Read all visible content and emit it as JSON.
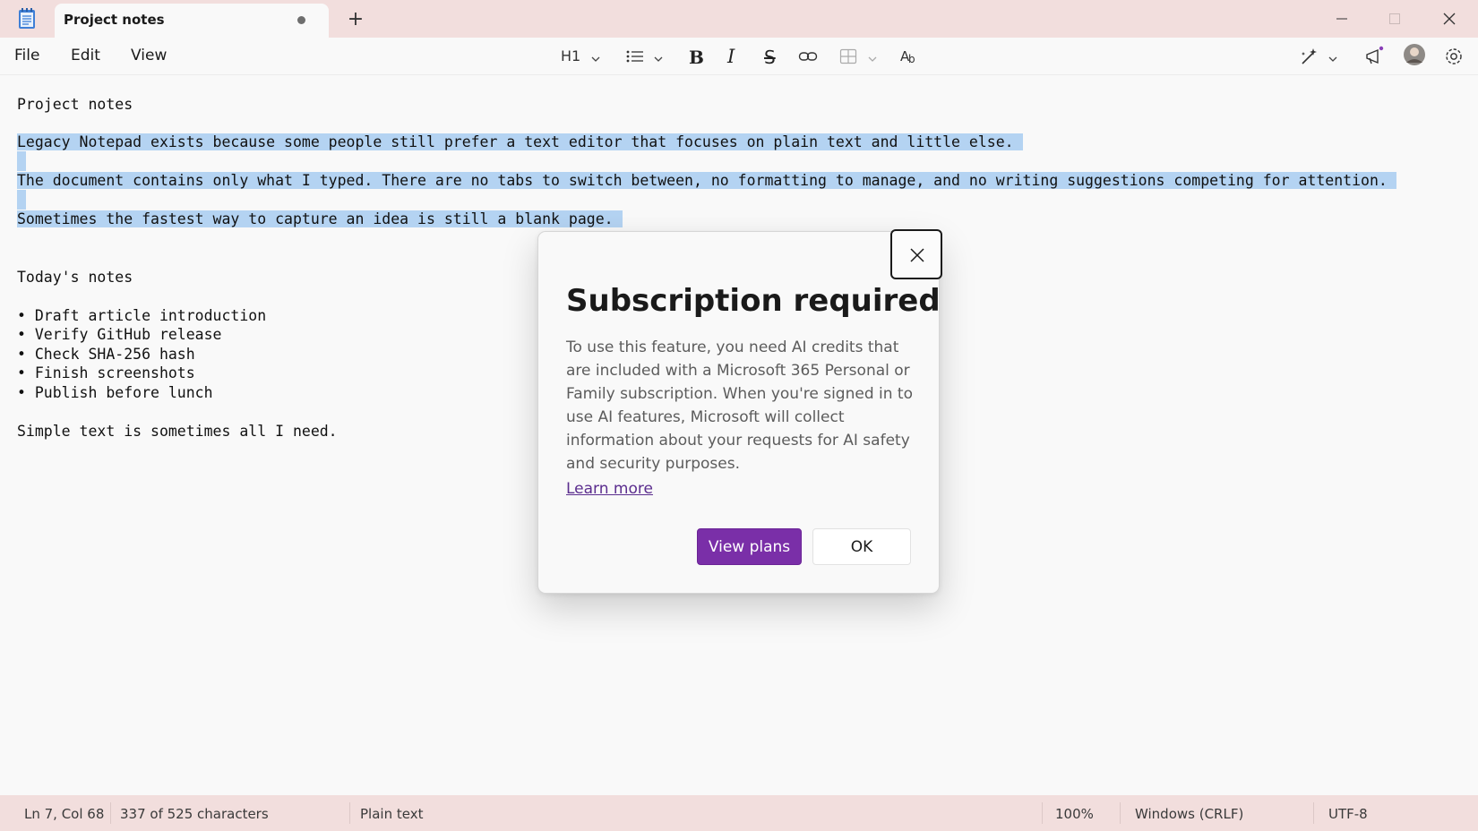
{
  "tab": {
    "title": "Project notes",
    "new_tab": "+"
  },
  "menu": {
    "file": "File",
    "edit": "Edit",
    "view": "View"
  },
  "toolbar": {
    "heading": "H1",
    "bold": "B",
    "italic": "I",
    "strike": "S"
  },
  "editor": {
    "lines": [
      "Project notes",
      "Legacy Notepad exists because some people still prefer a text editor that focuses on plain text and little else.",
      "The document contains only what I typed. There are no tabs to switch between, no formatting to manage, and no writing suggestions competing for attention.",
      "Sometimes the fastest way to capture an idea is still a blank page.",
      "Today's notes",
      "• Draft article introduction",
      "• Verify GitHub release",
      "• Check SHA-256 hash",
      "• Finish screenshots",
      "• Publish before lunch",
      "Simple text is sometimes all I need."
    ],
    "selection_color": "#b4d3f2"
  },
  "dialog": {
    "title": "Subscription required",
    "body": "To use this feature, you need AI credits that are included with a Microsoft 365 Personal or Family subscription. When you're signed in to use AI features, Microsoft will collect information about your requests for AI safety and security purposes.",
    "link": "Learn more",
    "primary_button": "View plans",
    "secondary_button": "OK",
    "accent_color": "#7a2fa8"
  },
  "status": {
    "position": "Ln 7, Col 68",
    "characters": "337 of 525 characters",
    "format": "Plain text",
    "zoom": "100%",
    "line_ending": "Windows (CRLF)",
    "encoding": "UTF-8"
  },
  "icons": {
    "app": "notepad-icon",
    "unsaved": "unsaved-dot-icon",
    "list": "bullet-list-icon",
    "link": "link-icon",
    "table": "table-icon",
    "spellcheck": "spellcheck-icon",
    "copilot": "copilot-pen-icon",
    "megaphone": "megaphone-icon",
    "settings": "gear-icon",
    "close": "close-icon"
  },
  "theme": {
    "titlebar": "#f2dedd",
    "background": "#f9f9f9"
  }
}
